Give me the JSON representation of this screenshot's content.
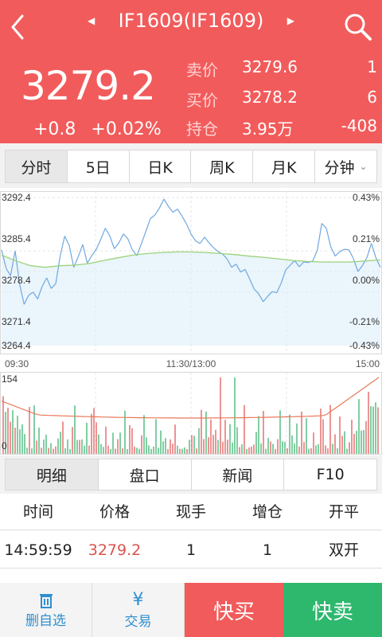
{
  "header": {
    "title": "IF1609(IF1609)",
    "price": "3279.2",
    "change": "+0.8",
    "change_pct": "+0.02%",
    "quotes": [
      {
        "label": "卖价",
        "value": "3279.6",
        "num": "1"
      },
      {
        "label": "买价",
        "value": "3278.2",
        "num": "6"
      },
      {
        "label": "持仓",
        "value": "3.95万",
        "num": "-408"
      }
    ]
  },
  "period_tabs": [
    {
      "label": "分时",
      "active": true
    },
    {
      "label": "5日"
    },
    {
      "label": "日K"
    },
    {
      "label": "周K"
    },
    {
      "label": "月K"
    },
    {
      "label": "分钟"
    }
  ],
  "chart": {
    "left_labels": [
      "3292.4",
      "3285.4",
      "3278.4",
      "3271.4",
      "3264.4"
    ],
    "right_labels": [
      "0.43%",
      "0.21%",
      "0.00%",
      "-0.21%",
      "-0.43%"
    ],
    "time_labels": [
      "09:30",
      "11:30/13:00",
      "15:00"
    ],
    "vol_top": "154",
    "vol_bottom": "0"
  },
  "chart_data": {
    "type": "line",
    "x": [
      "09:30",
      "11:30/13:00",
      "15:00"
    ],
    "ylim": [
      3264.4,
      3292.4
    ],
    "y_ticks": [
      3292.4,
      3285.4,
      3278.4,
      3271.4,
      3264.4
    ],
    "pct_ticks": [
      "0.43%",
      "0.21%",
      "0.00%",
      "-0.21%",
      "-0.43%"
    ],
    "price": [
      3282.5,
      3279.0,
      3277.6,
      3282.3,
      3276.0,
      3272.2,
      3273.9,
      3274.5,
      3273.2,
      3275.6,
      3277.2,
      3275.2,
      3276.1,
      3281.4,
      3285.1,
      3283.3,
      3279.2,
      3281.2,
      3283.5,
      3280.0,
      3281.4,
      3282.6,
      3284.5,
      3286.6,
      3285.1,
      3282.7,
      3283.8,
      3285.5,
      3284.6,
      3282.5,
      3281.4,
      3283.7,
      3286.0,
      3288.4,
      3289.1,
      3290.4,
      3292.1,
      3290.7,
      3289.6,
      3290.2,
      3288.9,
      3287.4,
      3285.5,
      3284.2,
      3283.7,
      3284.9,
      3283.8,
      3282.9,
      3282.2,
      3281.7,
      3280.8,
      3279.2,
      3279.8,
      3278.3,
      3278.8,
      3277.0,
      3275.1,
      3274.2,
      3272.7,
      3273.7,
      3274.6,
      3274.4,
      3276.2,
      3278.7,
      3279.6,
      3280.5,
      3279.3,
      3280.2,
      3280.1,
      3280.4,
      3282.4,
      3287.5,
      3286.6,
      3283.0,
      3281.3,
      3282.2,
      3282.6,
      3282.5,
      3280.9,
      3278.4,
      3279.5,
      3281.0,
      3283.7,
      3281.0,
      3279.2
    ],
    "avg": [
      3281.5,
      3280.4,
      3279.5,
      3279.2,
      3279.5,
      3279.6,
      3279.9,
      3280.5,
      3281.0,
      3281.5,
      3281.8,
      3282.0,
      3282.1,
      3282.1,
      3282.0,
      3281.8,
      3281.6,
      3281.3,
      3281.1,
      3280.8,
      3280.5,
      3280.3,
      3280.2,
      3280.2,
      3280.2,
      3280.4,
      3280.6
    ],
    "volume_ylim": [
      0,
      154
    ]
  },
  "info_tabs": [
    {
      "label": "明细",
      "active": true
    },
    {
      "label": "盘口"
    },
    {
      "label": "新闻"
    },
    {
      "label": "F10"
    }
  ],
  "table": {
    "headers": [
      "时间",
      "价格",
      "现手",
      "增仓",
      "开平"
    ],
    "rows": [
      [
        "14:59:59",
        "3279.2",
        "1",
        "1",
        "双开"
      ]
    ]
  },
  "bottom": {
    "remove_label": "删自选",
    "trade_label": "交易",
    "buy_label": "快买",
    "sell_label": "快卖"
  }
}
